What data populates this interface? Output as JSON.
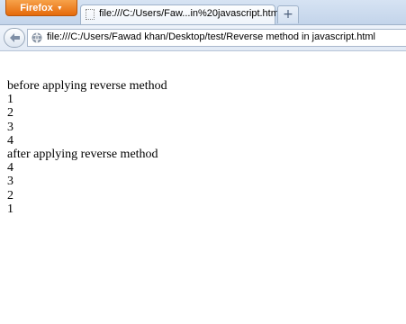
{
  "browser": {
    "app_button_label": "Firefox",
    "new_tab_label": "+",
    "tabs": [
      {
        "title": "file:///C:/Users/Faw...in%20javascript.html"
      }
    ],
    "url": "file:///C:/Users/Fawad khan/Desktop/test/Reverse method in javascript.html"
  },
  "page": {
    "before_heading": "before applying reverse method",
    "before_values": [
      "1",
      "2",
      "3",
      "4"
    ],
    "after_heading": "after applying reverse method",
    "after_values": [
      "4",
      "3",
      "2",
      "1"
    ]
  }
}
